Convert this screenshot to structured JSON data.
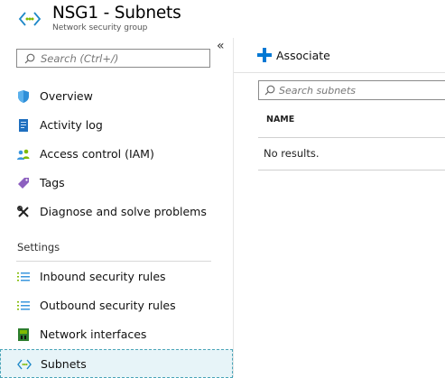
{
  "header": {
    "title": "NSG1 - Subnets",
    "subtitle": "Network security group",
    "icon": "subnet-brackets-icon"
  },
  "sidebar": {
    "collapse_glyph": "«",
    "search_placeholder": "Search (Ctrl+/)",
    "items": [
      {
        "label": "Overview",
        "icon": "shield-icon"
      },
      {
        "label": "Activity log",
        "icon": "activity-log-icon"
      },
      {
        "label": "Access control (IAM)",
        "icon": "people-icon"
      },
      {
        "label": "Tags",
        "icon": "tag-icon"
      },
      {
        "label": "Diagnose and solve problems",
        "icon": "wrench-icon"
      }
    ],
    "section_heading": "Settings",
    "settings_items": [
      {
        "label": "Inbound security rules",
        "icon": "rules-list-icon"
      },
      {
        "label": "Outbound security rules",
        "icon": "rules-list-icon"
      },
      {
        "label": "Network interfaces",
        "icon": "network-interface-icon"
      },
      {
        "label": "Subnets",
        "icon": "subnet-brackets-icon",
        "active": true
      }
    ]
  },
  "main": {
    "associate_label": "Associate",
    "search_placeholder": "Search subnets",
    "columns": [
      "NAME"
    ],
    "empty_text": "No results."
  },
  "colors": {
    "accent": "#0078d4",
    "active_bg": "#e7f4f8",
    "active_border": "#4aa5b8"
  }
}
